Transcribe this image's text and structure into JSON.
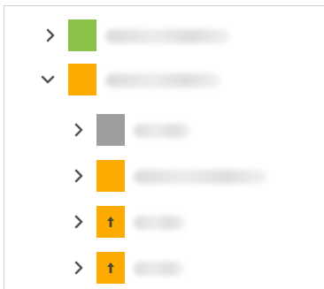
{
  "tree": {
    "items": [
      {
        "name": "item-1",
        "level": 0,
        "expanded": false,
        "icon": "green-square",
        "color": "#8bc34a",
        "badge": ""
      },
      {
        "name": "item-2",
        "level": 0,
        "expanded": true,
        "icon": "orange-square",
        "color": "#ffaa00",
        "badge": ""
      },
      {
        "name": "item-2-1",
        "level": 1,
        "expanded": false,
        "icon": "gray-square",
        "color": "#9e9e9e",
        "badge": ""
      },
      {
        "name": "item-2-2",
        "level": 1,
        "expanded": false,
        "icon": "orange-square",
        "color": "#ffaa00",
        "badge": ""
      },
      {
        "name": "item-2-3",
        "level": 1,
        "expanded": false,
        "icon": "orange-square-up-arrow",
        "color": "#ffaa00",
        "badge": "up-arrow"
      },
      {
        "name": "item-2-4",
        "level": 1,
        "expanded": false,
        "icon": "orange-square-up-arrow",
        "color": "#ffaa00",
        "badge": "up-arrow"
      }
    ]
  },
  "colors": {
    "chevron": "#555555",
    "arrow": "#4a4a2a"
  }
}
